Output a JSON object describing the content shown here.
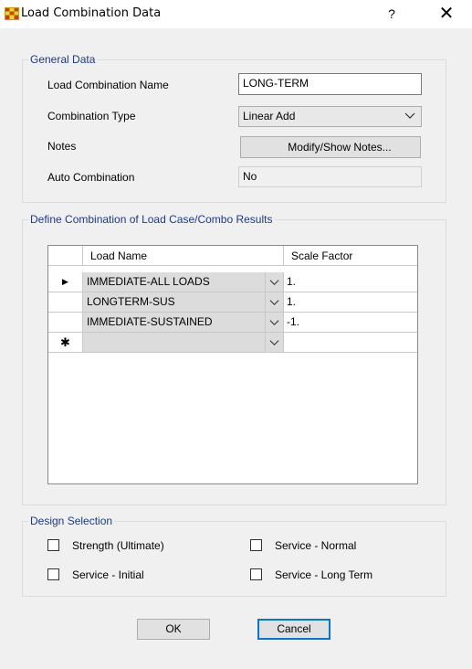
{
  "window": {
    "title": "Load Combination Data",
    "help": "?",
    "close": "✕"
  },
  "general": {
    "legend": "General Data",
    "name_label": "Load Combination Name",
    "name_value": "LONG-TERM",
    "type_label": "Combination Type",
    "type_value": "Linear Add",
    "notes_label": "Notes",
    "notes_button": "Modify/Show Notes...",
    "auto_label": "Auto Combination",
    "auto_value": "No"
  },
  "define": {
    "legend": "Define Combination of Load Case/Combo Results",
    "col_load": "Load Name",
    "col_scale": "Scale Factor",
    "rows": [
      {
        "marker": "▶",
        "load": "IMMEDIATE-ALL LOADS",
        "scale": "1."
      },
      {
        "marker": "",
        "load": "LONGTERM-SUS",
        "scale": "1."
      },
      {
        "marker": "",
        "load": "IMMEDIATE-SUSTAINED",
        "scale": "-1."
      },
      {
        "marker": "✱",
        "load": "",
        "scale": ""
      }
    ]
  },
  "design": {
    "legend": "Design Selection",
    "strength": "Strength (Ultimate)",
    "service_initial": "Service - Initial",
    "service_normal": "Service - Normal",
    "service_longterm": "Service - Long Term"
  },
  "buttons": {
    "ok": "OK",
    "cancel": "Cancel"
  },
  "colors": {
    "legend": "#1a3a8a",
    "titlebar": "#ffffff",
    "dialog": "#f0f0f0",
    "focus_border": "#0078d7"
  }
}
